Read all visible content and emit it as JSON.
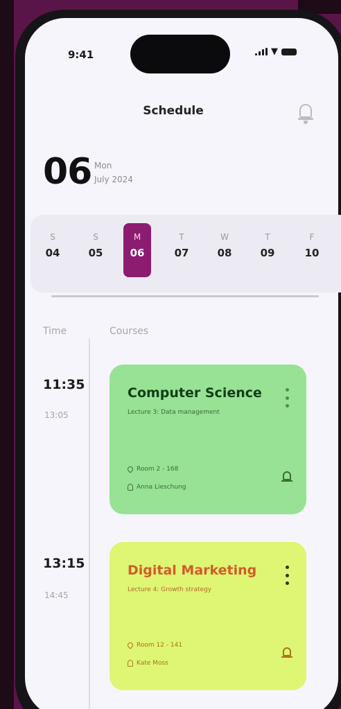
{
  "colors": {
    "accent": "#8b1c70",
    "card_green": "#97e294",
    "card_yellow": "#dff574",
    "background": "#5a1548"
  },
  "status_bar": {
    "time": "9:41",
    "icons": [
      "signal-icon",
      "wifi-icon",
      "battery-icon"
    ]
  },
  "header": {
    "title": "Schedule",
    "right_icon": "bell-icon"
  },
  "date": {
    "day_number": "06",
    "weekday": "Mon",
    "month_year": "July 2024"
  },
  "week": [
    {
      "letter": "S",
      "number": "04"
    },
    {
      "letter": "S",
      "number": "05"
    },
    {
      "letter": "M",
      "number": "06",
      "selected": true
    },
    {
      "letter": "T",
      "number": "07"
    },
    {
      "letter": "W",
      "number": "08"
    },
    {
      "letter": "T",
      "number": "09"
    },
    {
      "letter": "F",
      "number": "10"
    }
  ],
  "columns": {
    "time": "Time",
    "courses": "Courses"
  },
  "courses": [
    {
      "start": "11:35",
      "end": "13:05",
      "title": "Computer Science",
      "subtitle": "Lecture 3: Data management",
      "room": "Room 2 - 168",
      "teacher": "Anna Lieschung",
      "icon": "bell-icon"
    },
    {
      "start": "13:15",
      "end": "14:45",
      "title": "Digital Marketing",
      "subtitle": "Lecture 4: Growth strategy",
      "room": "Room 12 - 141",
      "teacher": "Kate Moss",
      "icon": "bell-icon"
    }
  ]
}
